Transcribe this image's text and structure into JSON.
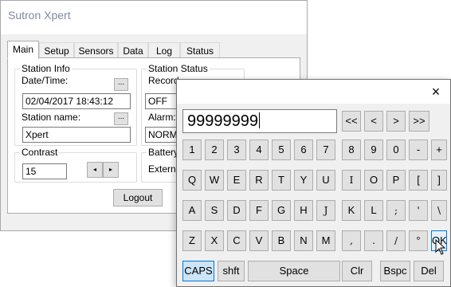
{
  "app": {
    "title": "Sutron Xpert",
    "tabs": [
      "Main",
      "Setup",
      "Sensors",
      "Data",
      "Log",
      "Status"
    ],
    "active_tab": "Main",
    "station_info": {
      "group_label": "Station Info",
      "datetime_label": "Date/Time:",
      "datetime_value": "02/04/2017 18:43:12",
      "name_label": "Station name:",
      "name_value": "Xpert",
      "browse_label": "..."
    },
    "station_status": {
      "group_label": "Station Status",
      "recording_label": "Record",
      "recording_value": "OFF",
      "alarm_label": "Alarm:",
      "alarm_value": "NORM"
    },
    "contrast": {
      "group_label": "Contrast",
      "value": "15",
      "left_arrow": "◂",
      "right_arrow": "▸"
    },
    "battery": {
      "group_label": "Battery",
      "external_label": "Externa"
    },
    "logout_label": "Logout"
  },
  "keyboard": {
    "close_glyph": "×",
    "entry_value": "99999999",
    "nav_keys": [
      "<<",
      "<",
      ">",
      ">>"
    ],
    "rows": [
      [
        "1",
        "2",
        "3",
        "4",
        "5",
        "6",
        "7",
        "8",
        "9",
        "0",
        "-",
        "+"
      ],
      [
        "Q",
        "W",
        "E",
        "R",
        "T",
        "Y",
        "U",
        "I",
        "O",
        "P",
        "[",
        "]"
      ],
      [
        "A",
        "S",
        "D",
        "F",
        "G",
        "H",
        "J",
        "K",
        "L",
        ";",
        "'",
        "\\"
      ],
      [
        "Z",
        "X",
        "C",
        "V",
        "B",
        "N",
        "M",
        ",",
        ".",
        "/",
        "°",
        "OK"
      ]
    ],
    "bottom_row": {
      "caps": "CAPS",
      "shift": "shft",
      "space": "Space",
      "clear": "Clr",
      "backspace": "Bspc",
      "delete": "Del"
    },
    "active_toggle": "CAPS",
    "hovered_key": "OK",
    "accent_color": "#0078d7"
  }
}
